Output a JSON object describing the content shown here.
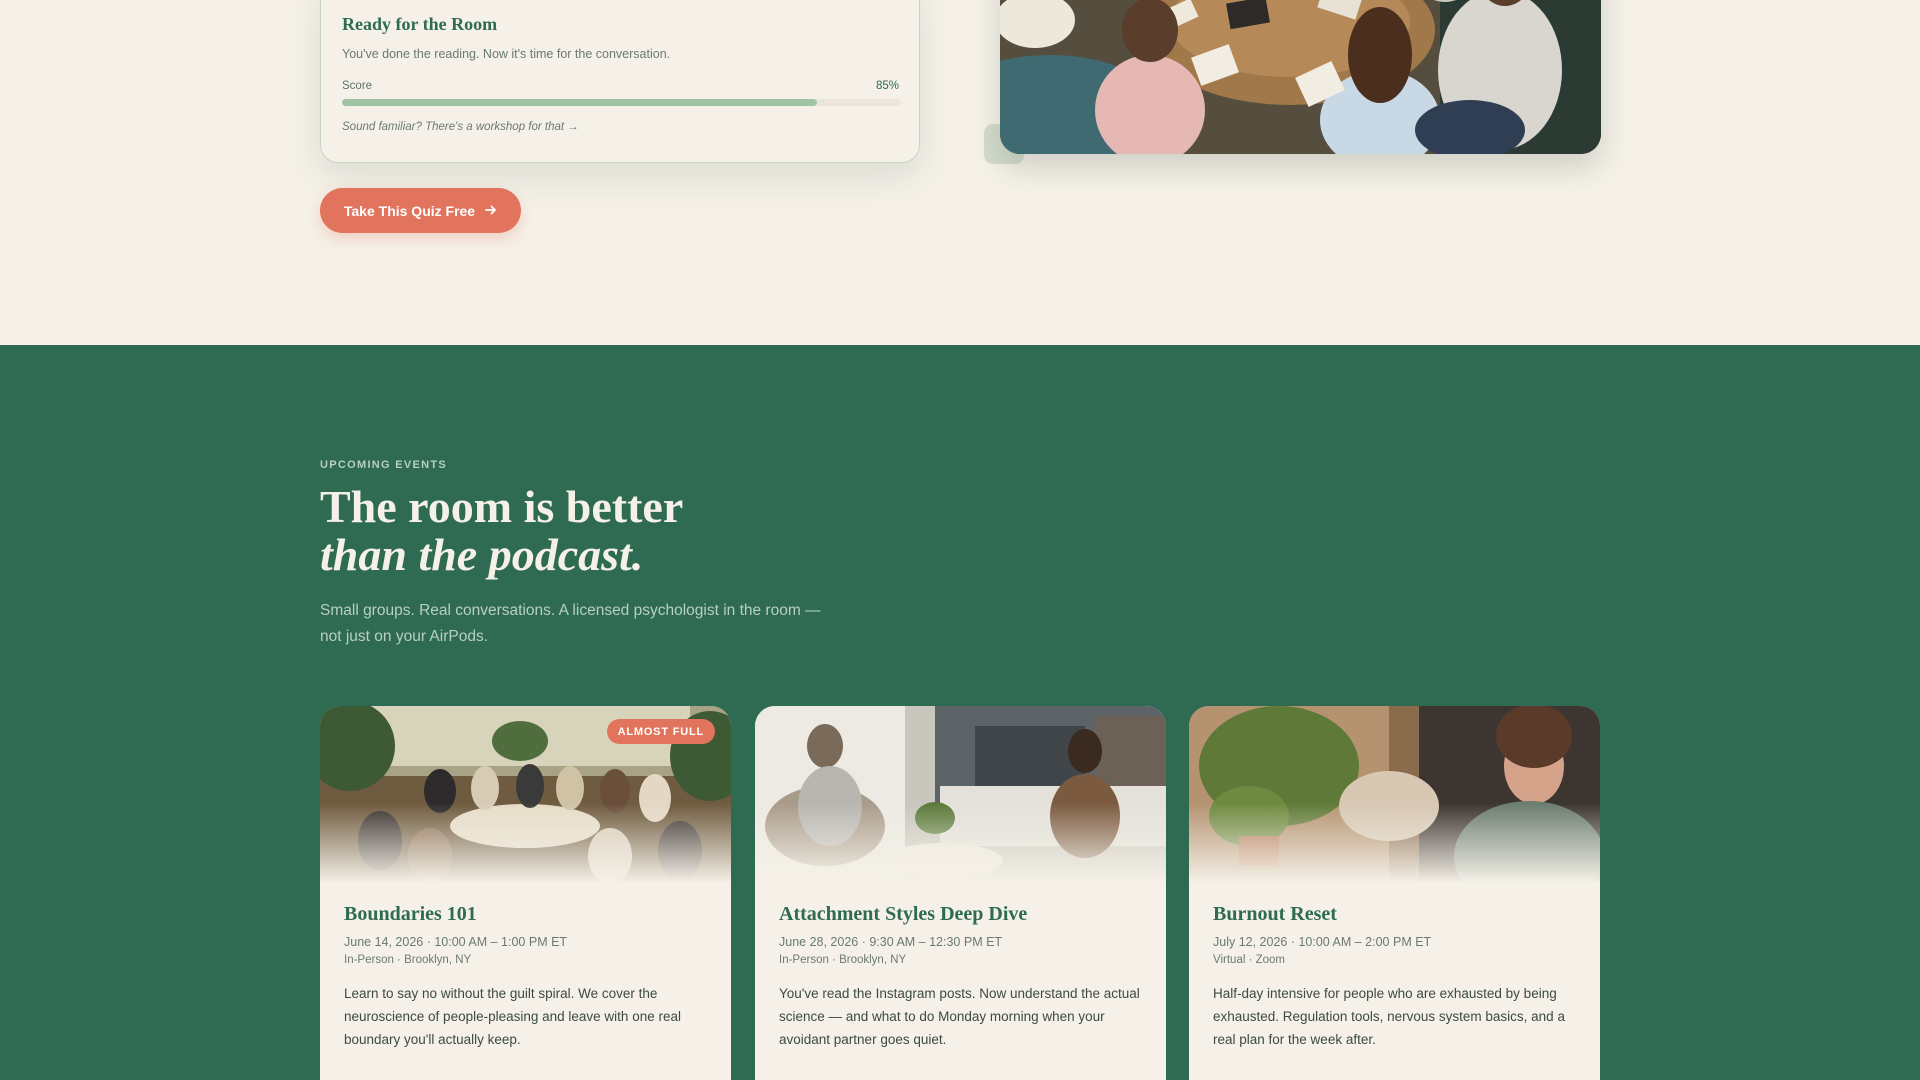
{
  "quiz_card": {
    "title": "Ready for the Room",
    "subtitle": "You've done the reading. Now it's time for the conversation.",
    "score_label": "Score",
    "score_value": "85%",
    "score_fraction": 0.85,
    "note": "Sound familiar? There's a workshop for that →"
  },
  "cta": {
    "label": "Take This Quiz Free",
    "icon": "arrow-right-icon"
  },
  "events": {
    "eyebrow": "UPCOMING EVENTS",
    "headline_line1": "The room is better",
    "headline_line2": "than the podcast.",
    "lede": "Small groups. Real conversations. A licensed psychologist in the room — not just on your AirPods.",
    "cards": [
      {
        "badge": "ALMOST FULL",
        "title": "Boundaries 101",
        "date": "June 14, 2026 · 10:00 AM – 1:00 PM ET",
        "location": "In-Person · Brooklyn, NY",
        "description": "Learn to say no without the guilt spiral. We cover the neuroscience of people-pleasing and leave with one real boundary you'll actually keep."
      },
      {
        "title": "Attachment Styles Deep Dive",
        "date": "June 28, 2026 · 9:30 AM – 12:30 PM ET",
        "location": "In-Person · Brooklyn, NY",
        "description": "You've read the Instagram posts. Now understand the actual science — and what to do Monday morning when your avoidant partner goes quiet."
      },
      {
        "title": "Burnout Reset",
        "date": "July 12, 2026 · 10:00 AM – 2:00 PM ET",
        "location": "Virtual · Zoom",
        "description": "Half-day intensive for people who are exhausted by being exhausted. Regulation tools, nervous system basics, and a real plan for the week after."
      }
    ]
  },
  "colors": {
    "cream": "#f5f1e8",
    "forest_green": "#2e6b52",
    "coral": "#e2735c",
    "sage": "#9fc4a3"
  }
}
